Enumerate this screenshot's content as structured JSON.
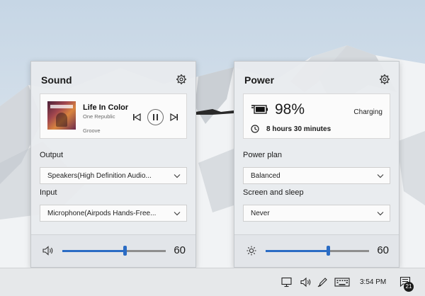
{
  "sound": {
    "title": "Sound",
    "settings_icon": "gear-icon",
    "media": {
      "title": "Life In Color",
      "artist": "One Republic",
      "app": "Groove",
      "controls": [
        "previous-track-icon",
        "pause-icon",
        "next-track-icon"
      ]
    },
    "output_label": "Output",
    "output_value": "Speakers(High Definition Audio...",
    "input_label": "Input",
    "input_value": "Microphone(Airpods Hands-Free...",
    "volume_icon": "speaker-icon",
    "volume": "60",
    "volume_level": 0.6
  },
  "power": {
    "title": "Power",
    "settings_icon": "gear-icon",
    "battery_percent": "98%",
    "battery_level": 0.98,
    "status": "Charging",
    "time_remaining": "8 hours 30 minutes",
    "plan_label": "Power plan",
    "plan_value": "Balanced",
    "sleep_label": "Screen and sleep",
    "sleep_value": "Never",
    "brightness_icon": "sun-icon",
    "brightness": "60",
    "brightness_level": 0.6
  },
  "taskbar": {
    "tray_icons": [
      "monitor-icon",
      "speaker-icon",
      "pen-icon",
      "keyboard-icon"
    ],
    "clock": "3:54 PM",
    "notification_count": "21"
  },
  "colors": {
    "accent": "#2b6cc4",
    "panel_bg": "#e8ebee",
    "card_bg": "#fbfbfb",
    "taskbar_bg": "#e6e8ea"
  }
}
